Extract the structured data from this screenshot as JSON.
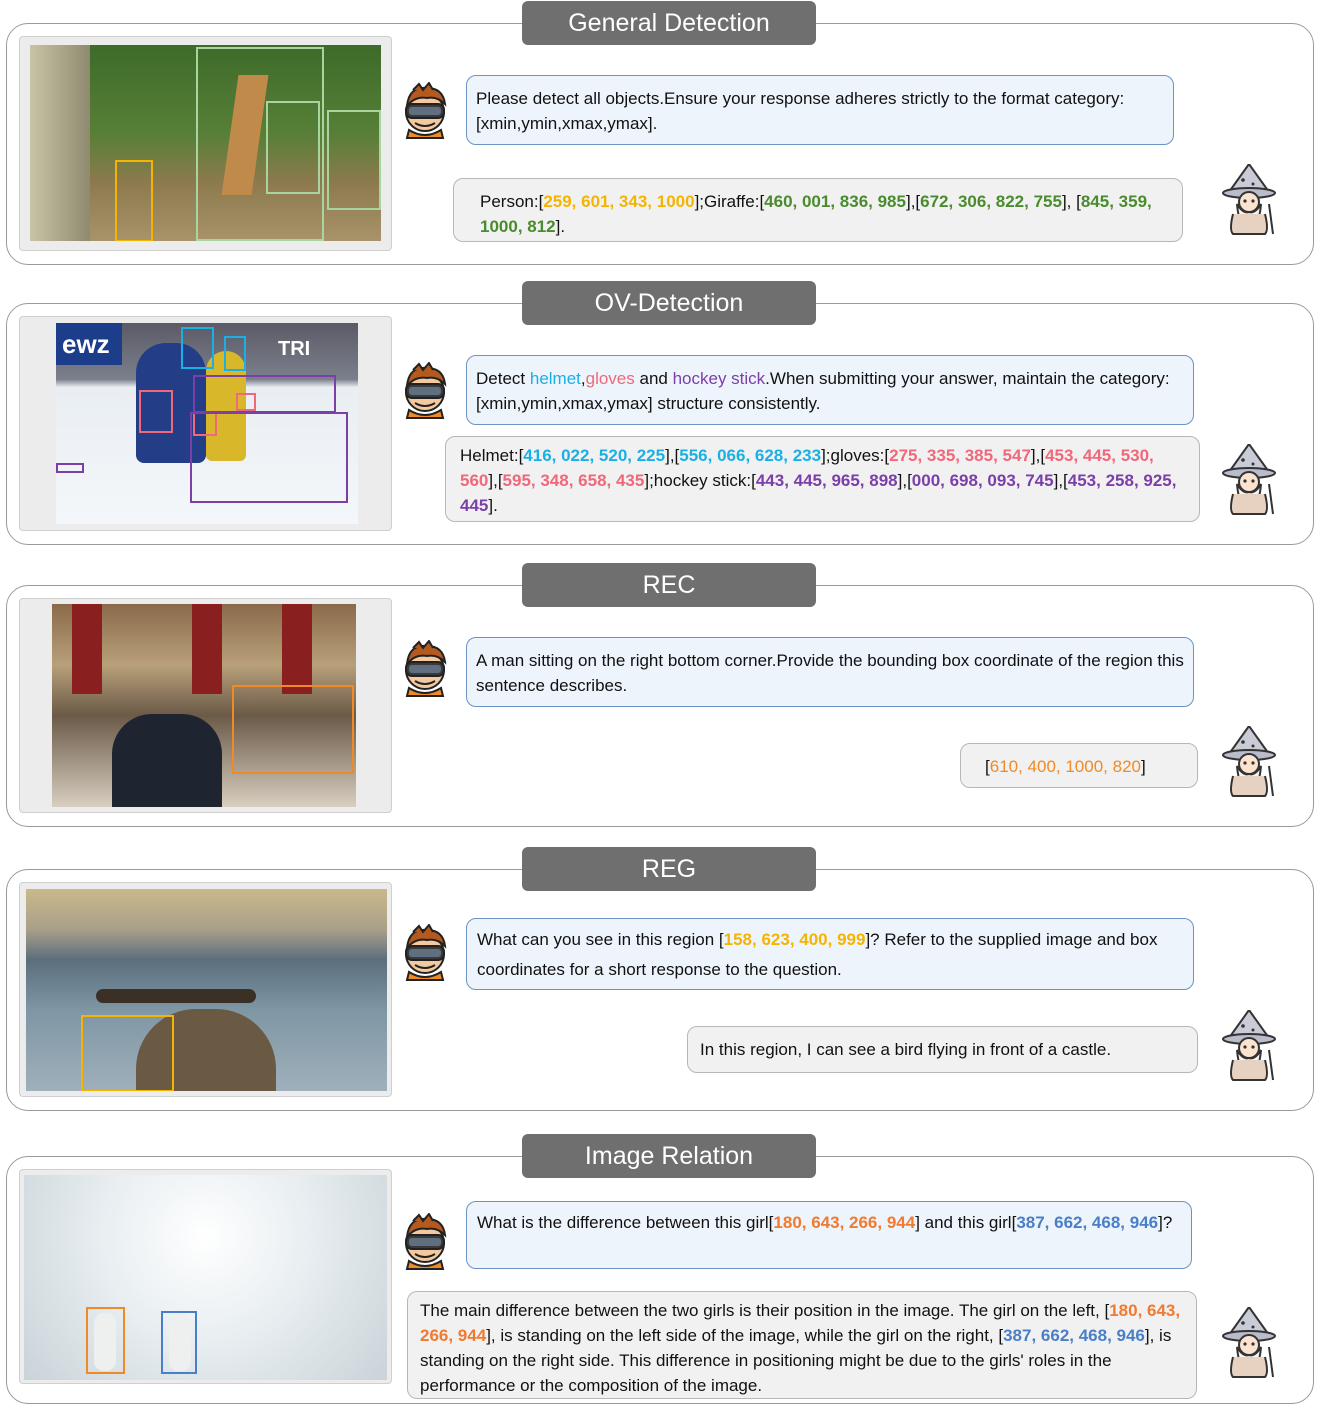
{
  "sections": [
    {
      "title": "General Detection",
      "question": "Please detect all objects.Ensure your response adheres strictly to the format category:[xmin,ymin,xmax,ymax].",
      "answer_p1": "Person:[",
      "answer_b1": "259, 601, 343, 1000",
      "answer_p2": "];Giraffe:[",
      "answer_b2": "460, 001, 836, 985",
      "answer_p3": "],[",
      "answer_b3": "672, 306, 822, 755",
      "answer_p4": "], [",
      "answer_b4": "845, 359, 1000, 812",
      "answer_p5": "]."
    },
    {
      "title": "OV-Detection",
      "q_p1": "Detect ",
      "q_helmet": "helmet",
      "q_comma": ",",
      "q_gloves": "gloves",
      "q_and": " and ",
      "q_stick": "hockey stick",
      "q_rest": ".When submitting your answer, maintain the category:[xmin,ymin,xmax,ymax] structure consistently.",
      "a_helmet": "Helmet:[",
      "a_h1": "416, 022, 520, 225",
      "a_s1": "],[",
      "a_h2": "556, 066, 628, 233",
      "a_gloves": "];gloves:[",
      "a_g1": "275, 335, 385, 547",
      "a_s2": "],[",
      "a_g2": "453, 445, 530, 560",
      "a_s3": "],[",
      "a_g3": "595, 348, 658, 435",
      "a_stick": "];hockey stick:[",
      "a_k1": "443, 445, 965, 898",
      "a_s4": "],[",
      "a_k2": "000, 698, 093, 745",
      "a_s5": "],[",
      "a_k3": "453, 258, 925, 445",
      "a_end": "]."
    },
    {
      "title": "REC",
      "question": "A man sitting on the right bottom corner.Provide the bounding box coordinate of the region this sentence describes.",
      "a_open": "[",
      "a_box": "610, 400, 1000, 820",
      "a_close": "]"
    },
    {
      "title": "REG",
      "q_p1": "What can you see in this region [",
      "q_box": "158, 623, 400, 999",
      "q_p2": "]? Refer to the supplied image and box coordinates for a short response to the question.",
      "answer": "In this region, I can see a bird flying in front of a castle."
    },
    {
      "title": "Image Relation",
      "q_p1": "What is the difference between this girl[",
      "q_b1": "180, 643, 266, 944",
      "q_p2": "] and this girl[",
      "q_b2": "387, 662, 468, 946",
      "q_p3": "]?",
      "a_p1": "The main difference between the two girls is their position in the image. The girl on the left, [",
      "a_b1": "180, 643, 266, 944",
      "a_p2": "], is standing on the left side of the image, while the girl on the right, [",
      "a_b2": "387, 662, 468, 946",
      "a_p3": "], is standing on the right side. This difference in positioning might be due to the girls' roles in the performance or the composition of the image."
    }
  ],
  "ov_logo_left": "ewz",
  "ov_logo_right": "TRI",
  "colors": {
    "yellow": "#f4b400",
    "green": "#4a8b2e",
    "blue": "#1ab0e6",
    "pink": "#f0687a",
    "purple": "#7b3fa8",
    "orange": "#f08a24",
    "steel": "#4a7fc8"
  },
  "icons": {
    "user": "vr-headset-user-icon",
    "assistant": "wizard-icon"
  }
}
